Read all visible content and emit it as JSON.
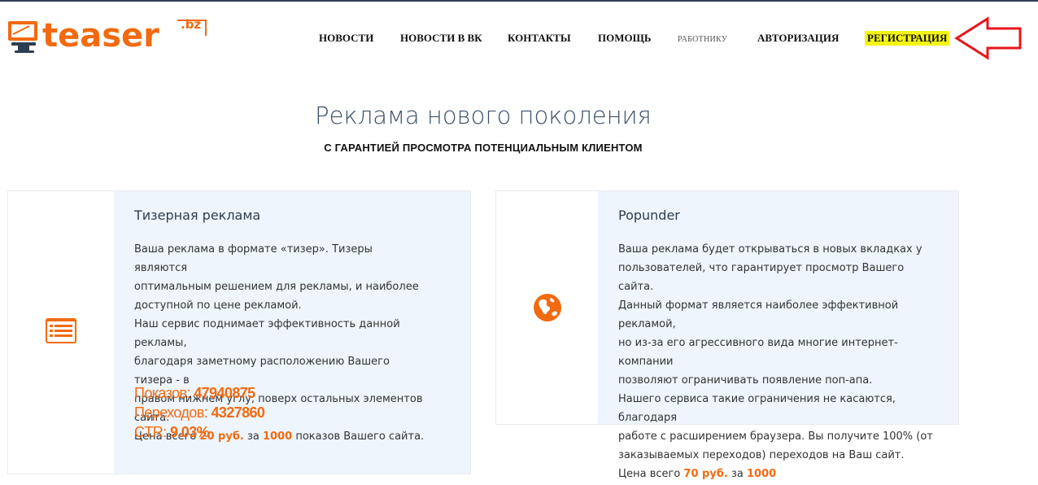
{
  "logo": {
    "text": "teaser",
    "tld": ".bz",
    "icon": "monitor-icon"
  },
  "nav": {
    "items": [
      {
        "label": "НОВОСТИ"
      },
      {
        "label": "НОВОСТИ В ВК"
      },
      {
        "label": "КОНТАКТЫ"
      },
      {
        "label": "ПОМОЩЬ"
      },
      {
        "label": "РАБОТНИКУ"
      },
      {
        "label": "АВТОРИЗАЦИЯ"
      },
      {
        "label": "РЕГИСТРАЦИЯ"
      }
    ]
  },
  "hero": {
    "title": "Реклама нового поколения",
    "subtitle": "С ГАРАНТИЕЙ ПРОСМОТРА ПОТЕНЦИАЛЬНЫМ КЛИЕНТОМ"
  },
  "cards": [
    {
      "icon": "list-icon",
      "title": "Тизерная реклама",
      "lines": [
        "Ваша реклама в формате «тизер». Тизеры являются",
        "оптимальным решением для рекламы, и наиболее",
        "доступной по цене рекламой.",
        "Наш сервис поднимает эффективность данной рекламы,",
        "благодаря заметному расположению Вашего тизера - в",
        "правом нижнем углу, поверх остальных элементов сайта."
      ],
      "price": {
        "prefix": "Цена всего ",
        "price": "20 руб.",
        "mid": " за ",
        "count": "1000",
        "suffix": " показов Вашего сайта."
      },
      "stats": [
        {
          "label": "Показов: ",
          "value": "47940875"
        },
        {
          "label": "Переходов: ",
          "value": "4327860"
        },
        {
          "label": "CTR: ",
          "value": "9.03%"
        }
      ]
    },
    {
      "icon": "globe-icon",
      "title": "Popunder",
      "lines": [
        "Ваша реклама будет открываться в новых вкладках у",
        "пользователей, что гарантирует просмотр Вашего сайта.",
        "Данный формат является наиболее эффективной рекламой,",
        "но из-за его агрессивного вида многие интернет-компании",
        "позволяют ограничивать появление поп-апа.",
        "Нашего сервиса такие ограничения не касаются, благодаря",
        "работе с расширением браузера. Вы получите 100% (от",
        "заказываемых переходов) переходов на Ваш сайт."
      ],
      "price": {
        "prefix": "Цена всего ",
        "price": "70 руб.",
        "mid": " за ",
        "count": "1000"
      }
    }
  ],
  "colors": {
    "accent": "#f26a10",
    "highlight": "#f5f516",
    "arrow": "#e8141c",
    "card_bg": "#eef5fc"
  }
}
